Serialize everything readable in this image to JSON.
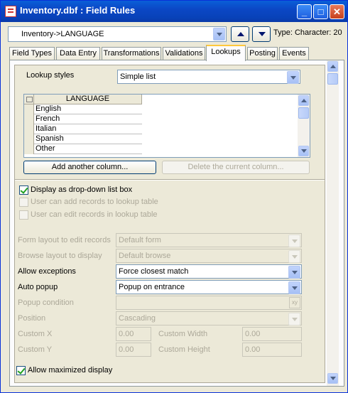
{
  "window": {
    "title": "Inventory.dbf : Field Rules"
  },
  "header": {
    "field_path": "Inventory->LANGUAGE",
    "type_text": "Type: Character: 20"
  },
  "tabs": [
    {
      "label": "Field Types"
    },
    {
      "label": "Data Entry"
    },
    {
      "label": "Transformations"
    },
    {
      "label": "Validations"
    },
    {
      "label": "Lookups"
    },
    {
      "label": "Posting"
    },
    {
      "label": "Events"
    }
  ],
  "active_tab": "Lookups",
  "lookups": {
    "styles_label": "Lookup styles",
    "styles_value": "Simple list",
    "grid": {
      "column": "LANGUAGE",
      "rows": [
        "English",
        "French",
        "Italian",
        "Spanish",
        "Other"
      ]
    },
    "add_column_label": "Add another column...",
    "delete_column_label": "Delete the current column...",
    "display_dropdown_label": "Display as drop-down list box",
    "user_add_label": "User can add records to lookup table",
    "user_edit_label": "User can edit records in lookup table",
    "form_layout_label": "Form layout to edit records",
    "form_layout_value": "Default form",
    "browse_layout_label": "Browse layout to display",
    "browse_layout_value": "Default browse",
    "allow_exceptions_label": "Allow exceptions",
    "allow_exceptions_value": "Force closest match",
    "auto_popup_label": "Auto popup",
    "auto_popup_value": "Popup on entrance",
    "popup_condition_label": "Popup condition",
    "position_label": "Position",
    "position_value": "Cascading",
    "custom_x_label": "Custom X",
    "custom_x_value": "0.00",
    "custom_y_label": "Custom Y",
    "custom_y_value": "0.00",
    "custom_width_label": "Custom Width",
    "custom_width_value": "0.00",
    "custom_height_label": "Custom Height",
    "custom_height_value": "0.00",
    "allow_maximized_label": "Allow maximized display"
  }
}
